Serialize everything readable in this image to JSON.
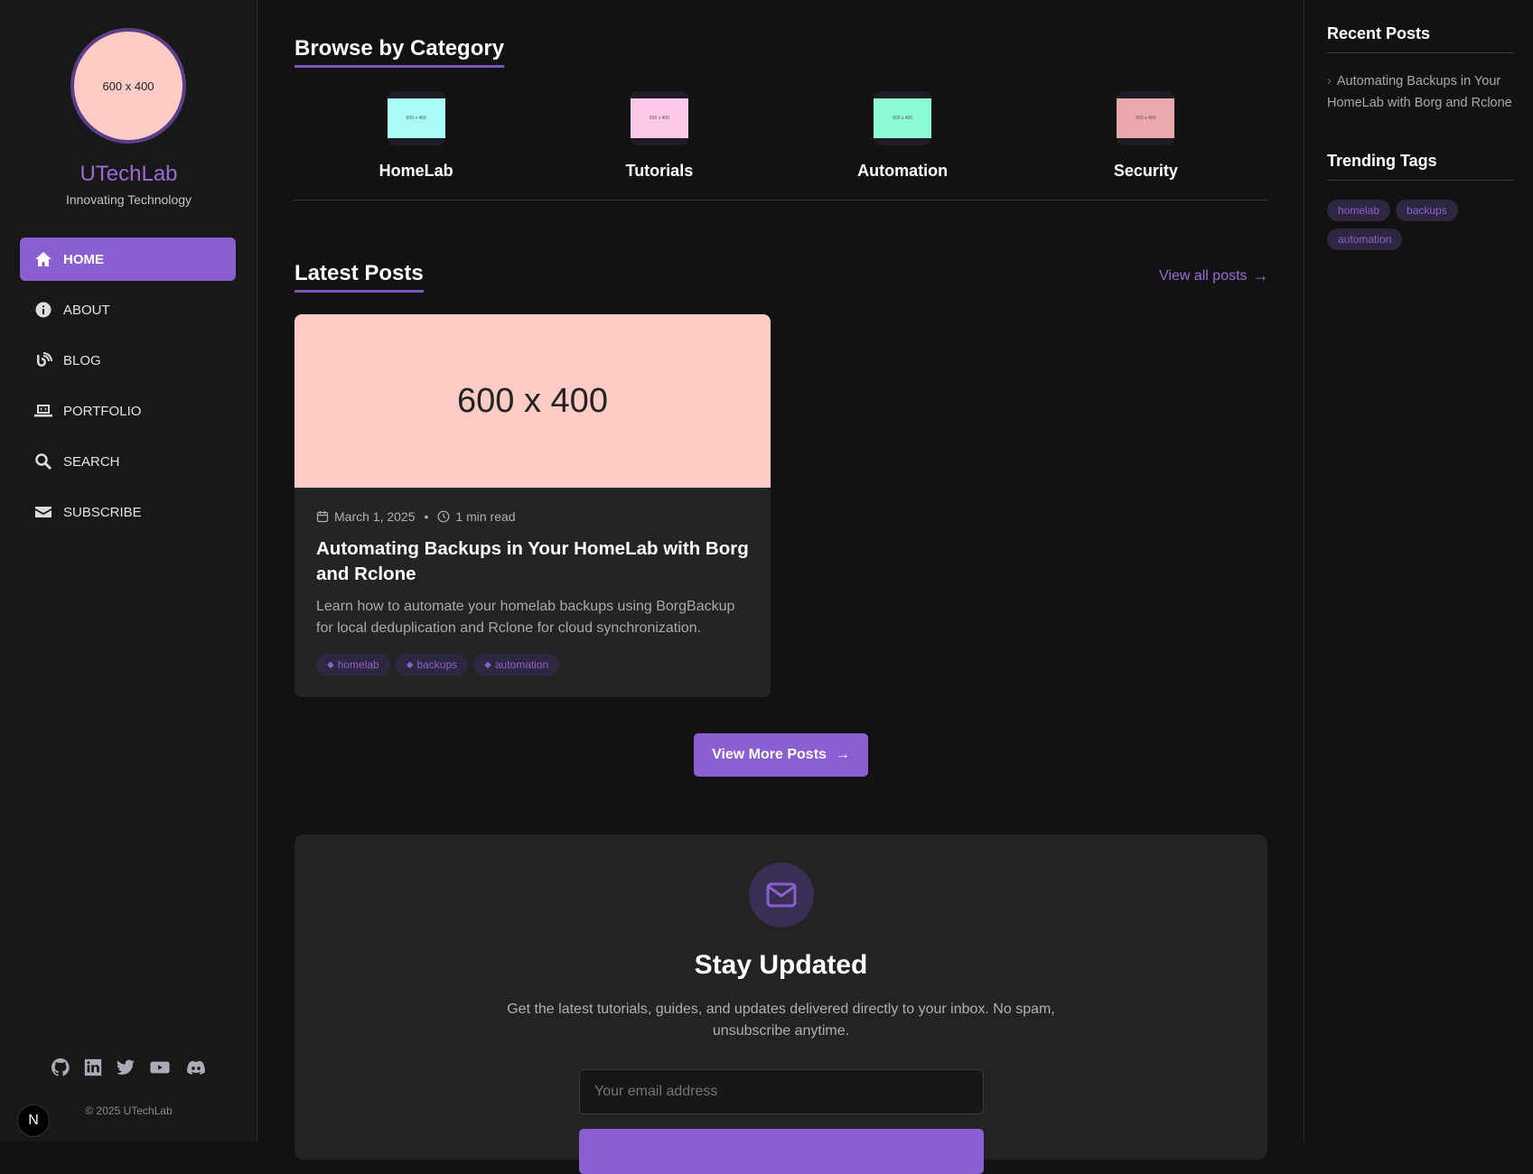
{
  "sidebar": {
    "avatar_text": "600 x 400",
    "site_name": "UTechLab",
    "tagline": "Innovating Technology",
    "nav": [
      {
        "label": "HOME",
        "icon": "home-icon",
        "active": true
      },
      {
        "label": "ABOUT",
        "icon": "info-icon"
      },
      {
        "label": "BLOG",
        "icon": "blog-icon"
      },
      {
        "label": "PORTFOLIO",
        "icon": "laptop-code-icon"
      },
      {
        "label": "SEARCH",
        "icon": "search-icon"
      },
      {
        "label": "SUBSCRIBE",
        "icon": "envelope-icon"
      }
    ],
    "social": [
      "github-icon",
      "linkedin-icon",
      "twitter-icon",
      "youtube-icon",
      "discord-icon"
    ],
    "copyright": "© 2025 UTechLab",
    "badge": "N"
  },
  "categories": {
    "title": "Browse by Category",
    "items": [
      {
        "label": "HomeLab",
        "img_text": "600 x 400",
        "color": "#a9fcf6"
      },
      {
        "label": "Tutorials",
        "img_text": "600 x 400",
        "color": "#fdc9ea"
      },
      {
        "label": "Automation",
        "img_text": "600 x 400",
        "color": "#8cfcd6"
      },
      {
        "label": "Security",
        "img_text": "600 x 400",
        "color": "#eaa8ab"
      }
    ]
  },
  "latest": {
    "title": "Latest Posts",
    "view_all": "View all posts",
    "post": {
      "img_text": "600 x 400",
      "date": "March 1, 2025",
      "read_time": "1 min read",
      "title": "Automating Backups in Your HomeLab with Borg and Rclone",
      "excerpt": "Learn how to automate your homelab backups using BorgBackup for local deduplication and Rclone for cloud synchronization.",
      "tags": [
        "homelab",
        "backups",
        "automation"
      ]
    },
    "more_button": "View More Posts"
  },
  "newsletter": {
    "title": "Stay Updated",
    "text": "Get the latest tutorials, guides, and updates delivered directly to your inbox. No spam, unsubscribe anytime.",
    "email_placeholder": "Your email address"
  },
  "right": {
    "recent_title": "Recent Posts",
    "recent": [
      "Automating Backups in Your HomeLab with Borg and Rclone"
    ],
    "tags_title": "Trending Tags",
    "tags": [
      "homelab",
      "backups",
      "automation"
    ]
  },
  "colors": {
    "accent": "#8b5fd1",
    "bg": "#121212"
  }
}
